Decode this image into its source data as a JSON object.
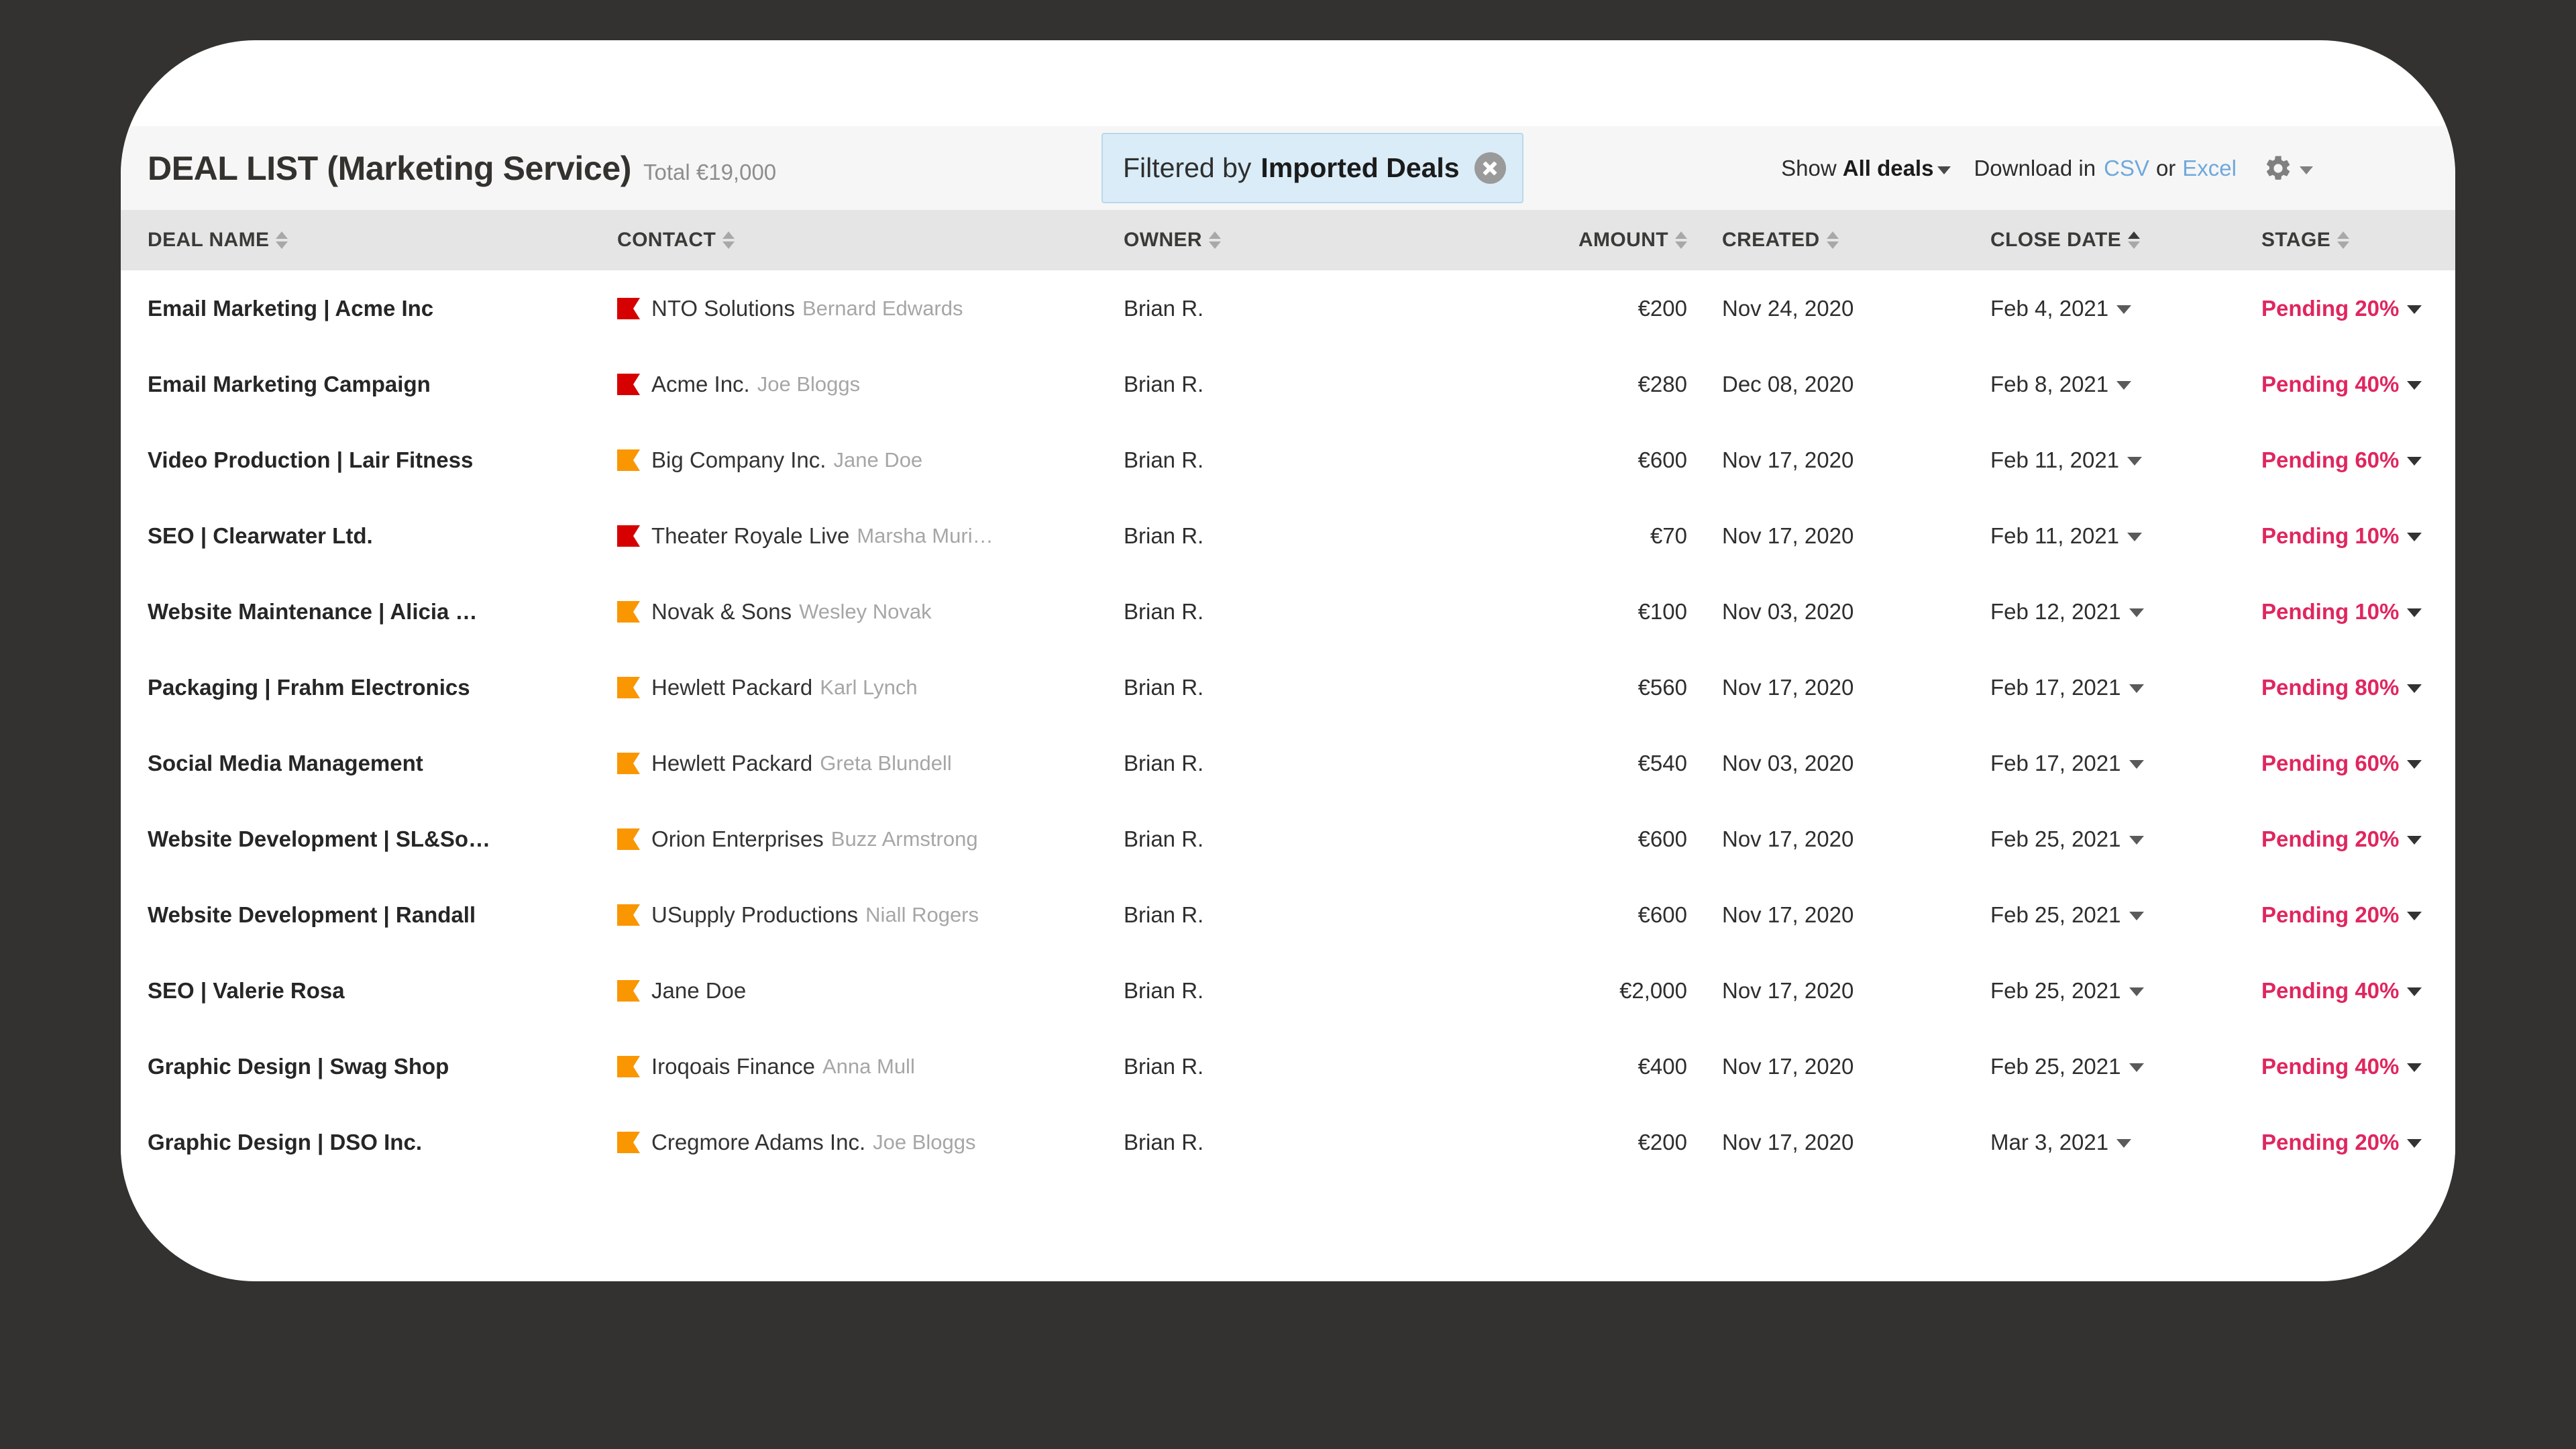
{
  "header": {
    "title": "DEAL LIST (Marketing Service)",
    "total": "Total €19,000",
    "filter": {
      "prefix": "Filtered by",
      "value": "Imported Deals",
      "close_icon": "close-circle-icon"
    },
    "toolbar": {
      "show_label": "Show",
      "show_value": "All deals",
      "download_label": "Download in",
      "csv_label": "CSV",
      "or_label": "or",
      "excel_label": "Excel",
      "gear_icon": "gear-icon"
    }
  },
  "colors": {
    "accent_stage": "#e0265f",
    "link": "#6fa8dc",
    "filter_pill_bg": "#d9ecf7",
    "flag_red": "#d60000",
    "flag_orange": "#fa9600",
    "panel_bg": "#ffffff",
    "page_bg": "#333231",
    "titlebar_bg": "#f6f6f6",
    "header_row_bg": "#e5e5e5"
  },
  "table": {
    "columns": [
      {
        "key": "deal_name",
        "label": "DEAL NAME",
        "sorted": false
      },
      {
        "key": "contact",
        "label": "CONTACT",
        "sorted": false
      },
      {
        "key": "owner",
        "label": "OWNER",
        "sorted": false
      },
      {
        "key": "amount",
        "label": "AMOUNT",
        "sorted": false
      },
      {
        "key": "created",
        "label": "CREATED",
        "sorted": false
      },
      {
        "key": "close_date",
        "label": "CLOSE DATE",
        "sorted": true
      },
      {
        "key": "stage",
        "label": "STAGE",
        "sorted": false
      }
    ],
    "rows": [
      {
        "deal_name": "Email Marketing | Acme Inc",
        "flag": "red",
        "company": "NTO Solutions",
        "person": "Bernard Edwards",
        "owner": "Brian R.",
        "amount": "€200",
        "created": "Nov 24, 2020",
        "close_date": "Feb 4, 2021",
        "stage": "Pending 20%"
      },
      {
        "deal_name": "Email Marketing Campaign",
        "flag": "red",
        "company": "Acme Inc.",
        "person": "Joe Bloggs",
        "owner": "Brian R.",
        "amount": "€280",
        "created": "Dec 08, 2020",
        "close_date": "Feb 8, 2021",
        "stage": "Pending 40%"
      },
      {
        "deal_name": "Video Production | Lair Fitness",
        "flag": "orange",
        "company": "Big Company Inc.",
        "person": "Jane Doe",
        "owner": "Brian R.",
        "amount": "€600",
        "created": "Nov 17, 2020",
        "close_date": "Feb 11, 2021",
        "stage": "Pending 60%"
      },
      {
        "deal_name": "SEO | Clearwater Ltd.",
        "flag": "red",
        "company": "Theater Royale Live",
        "person": "Marsha Muri…",
        "owner": "Brian R.",
        "amount": "€70",
        "created": "Nov 17, 2020",
        "close_date": "Feb 11, 2021",
        "stage": "Pending 10%"
      },
      {
        "deal_name": "Website Maintenance | Alicia …",
        "flag": "orange",
        "company": "Novak & Sons",
        "person": "Wesley Novak",
        "owner": "Brian R.",
        "amount": "€100",
        "created": "Nov 03, 2020",
        "close_date": "Feb 12, 2021",
        "stage": "Pending 10%"
      },
      {
        "deal_name": "Packaging | Frahm Electronics",
        "flag": "orange",
        "company": "Hewlett Packard",
        "person": "Karl Lynch",
        "owner": "Brian R.",
        "amount": "€560",
        "created": "Nov 17, 2020",
        "close_date": "Feb 17, 2021",
        "stage": "Pending 80%"
      },
      {
        "deal_name": "Social Media Management",
        "flag": "orange",
        "company": "Hewlett Packard",
        "person": "Greta Blundell",
        "owner": "Brian R.",
        "amount": "€540",
        "created": "Nov 03, 2020",
        "close_date": "Feb 17, 2021",
        "stage": "Pending 60%"
      },
      {
        "deal_name": "Website Development | SL&So…",
        "flag": "orange",
        "company": "Orion Enterprises",
        "person": "Buzz Armstrong",
        "owner": "Brian R.",
        "amount": "€600",
        "created": "Nov 17, 2020",
        "close_date": "Feb 25, 2021",
        "stage": "Pending 20%"
      },
      {
        "deal_name": "Website Development | Randall",
        "flag": "orange",
        "company": "USupply Productions",
        "person": "Niall Rogers",
        "owner": "Brian R.",
        "amount": "€600",
        "created": "Nov 17, 2020",
        "close_date": "Feb 25, 2021",
        "stage": "Pending 20%"
      },
      {
        "deal_name": "SEO | Valerie Rosa",
        "flag": "orange",
        "company": "Jane Doe",
        "person": "",
        "owner": "Brian R.",
        "amount": "€2,000",
        "created": "Nov 17, 2020",
        "close_date": "Feb 25, 2021",
        "stage": "Pending 40%"
      },
      {
        "deal_name": "Graphic Design | Swag Shop",
        "flag": "orange",
        "company": "Iroqoais Finance",
        "person": "Anna Mull",
        "owner": "Brian R.",
        "amount": "€400",
        "created": "Nov 17, 2020",
        "close_date": "Feb 25, 2021",
        "stage": "Pending 40%"
      },
      {
        "deal_name": "Graphic Design | DSO Inc.",
        "flag": "orange",
        "company": "Cregmore Adams Inc.",
        "person": "Joe Bloggs",
        "owner": "Brian R.",
        "amount": "€200",
        "created": "Nov 17, 2020",
        "close_date": "Mar 3, 2021",
        "stage": "Pending 20%"
      }
    ]
  }
}
